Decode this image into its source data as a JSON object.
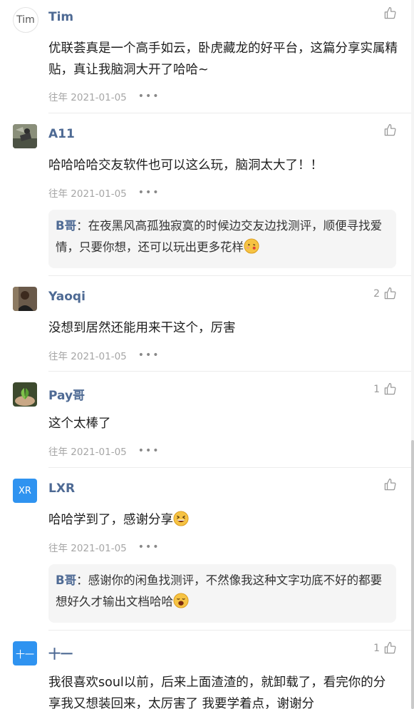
{
  "comments": [
    {
      "username": "Tim",
      "avatar_text": "Tim",
      "likes": "",
      "text": "优联荟真是一个高手如云，卧虎藏龙的好平台，这篇分享实属精贴，真让我脑洞大开了哈哈~",
      "date": "往年 2021-01-05"
    },
    {
      "username": "A11",
      "likes": "",
      "text": "哈哈哈哈交友软件也可以这么玩，脑洞太大了！！",
      "date": "往年 2021-01-05",
      "reply": {
        "author": "B哥",
        "separator": "：",
        "text": "在夜黑风高孤独寂寞的时候边交友边找测评，顺便寻找爱情，只要你想，还可以玩出更多花样"
      }
    },
    {
      "username": "Yaoqi",
      "likes": "2",
      "text": "没想到居然还能用来干这个，厉害",
      "date": "往年 2021-01-05"
    },
    {
      "username": "Pay哥",
      "likes": "1",
      "text": "这个太棒了",
      "date": "往年 2021-01-05"
    },
    {
      "username": "LXR",
      "avatar_text": "XR",
      "likes": "",
      "text": "哈哈学到了，感谢分享",
      "date": "往年 2021-01-05",
      "reply": {
        "author": "B哥",
        "separator": "：",
        "text": "感谢你的闲鱼找测评，不然像我这种文字功底不好的都要想好久才输出文档哈哈"
      }
    },
    {
      "username": "十一",
      "avatar_text": "十一",
      "likes": "1",
      "text": "我很喜欢soul以前，后来上面渣渣的，就卸载了，看完你的分享我又想装回来，太厉害了 我要学着点，谢谢分"
    }
  ],
  "icons": {
    "like": "thumbs-up-icon",
    "more": "more-dots-icon",
    "emoji_kiss": "kissing-face-emoji",
    "emoji_grin": "grinning-face-emoji",
    "emoji_weary": "weary-face-emoji"
  },
  "colors": {
    "username": "#4e6a94",
    "meta": "#a6a6a6",
    "avatar_blue": "#2f93f0",
    "reply_bg": "#f5f5f5"
  }
}
